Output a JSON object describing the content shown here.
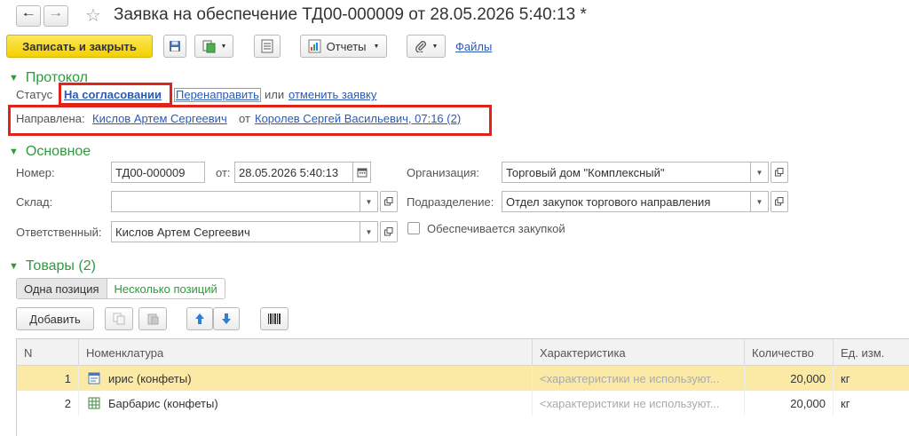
{
  "window": {
    "title": "Заявка на обеспечение ТД00-000009 от 28.05.2026 5:40:13 *"
  },
  "toolbar": {
    "save_close_label": "Записать и закрыть",
    "reports_label": "Отчеты",
    "files_label": "Файлы"
  },
  "protocol": {
    "header": "Протокол",
    "status_label": "Статус",
    "status_value": "На согласовании",
    "redirect_label": "Перенаправить",
    "or_text": "или",
    "cancel_label": "отменить заявку",
    "sent_label": "Направлена:",
    "sent_to": "Кислов Артем Сергеевич",
    "from_text": "от",
    "sent_from": "Королев Сергей Васильевич, 07:16 (2)"
  },
  "main": {
    "header": "Основное",
    "number_label": "Номер:",
    "number_value": "ТД00-000009",
    "date_label": "от:",
    "date_value": "28.05.2026  5:40:13",
    "org_label": "Организация:",
    "org_value": "Торговый дом \"Комплексный\"",
    "warehouse_label": "Склад:",
    "warehouse_value": "",
    "dept_label": "Подразделение:",
    "dept_value": "Отдел закупок торгового направления",
    "responsible_label": "Ответственный:",
    "responsible_value": "Кислов Артем Сергеевич",
    "purchase_label": "Обеспечивается закупкой"
  },
  "goods": {
    "header": "Товары (2)",
    "tab_single": "Одна позиция",
    "tab_multiple": "Несколько позиций",
    "add_label": "Добавить",
    "columns": {
      "n": "N",
      "nomenclature": "Номенклатура",
      "characteristic": "Характеристика",
      "quantity": "Количество",
      "unit": "Ед. изм."
    },
    "rows": [
      {
        "n": "1",
        "name": "ирис (конфеты)",
        "characteristic": "<характеристики не используют...",
        "quantity": "20,000",
        "unit": "кг"
      },
      {
        "n": "2",
        "name": "Барбарис (конфеты)",
        "characteristic": "<характеристики не используют...",
        "quantity": "20,000",
        "unit": "кг"
      }
    ]
  }
}
